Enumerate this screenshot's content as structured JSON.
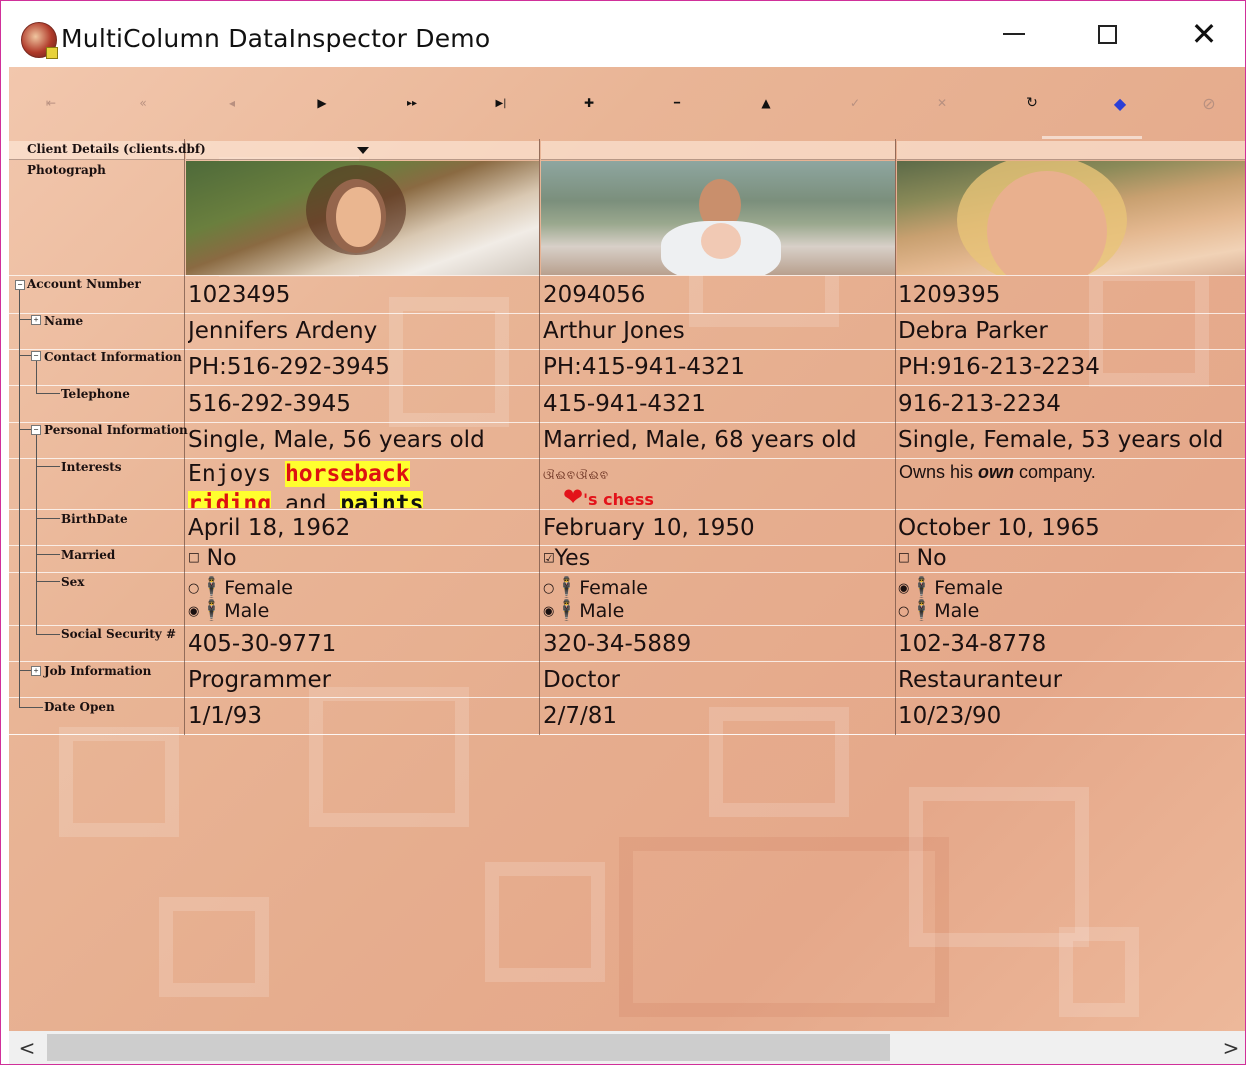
{
  "window": {
    "title": "MultiColumn DataInspector Demo",
    "minimize_icon": "minimize-icon",
    "maximize_icon": "maximize-icon",
    "close_glyph": "✕"
  },
  "toolbar": {
    "buttons": [
      {
        "name": "first-record",
        "glyph": "⇤",
        "enabled": false
      },
      {
        "name": "previous-page",
        "glyph": "«",
        "enabled": false
      },
      {
        "name": "previous-record",
        "glyph": "◂",
        "enabled": false
      },
      {
        "name": "next-record",
        "glyph": "▶",
        "enabled": true
      },
      {
        "name": "next-page",
        "glyph": "▸▸",
        "enabled": true
      },
      {
        "name": "last-record",
        "glyph": "▶|",
        "enabled": true
      },
      {
        "name": "insert-record",
        "glyph": "✚",
        "enabled": true
      },
      {
        "name": "delete-record",
        "glyph": "━",
        "enabled": true
      },
      {
        "name": "edit-record",
        "glyph": "▲",
        "enabled": true
      },
      {
        "name": "post-edit",
        "glyph": "✓",
        "enabled": false
      },
      {
        "name": "cancel-edit",
        "glyph": "✕",
        "enabled": false
      },
      {
        "name": "refresh-data",
        "glyph": "↻",
        "enabled": true
      },
      {
        "name": "apply-filter",
        "glyph": "◆",
        "enabled": true
      },
      {
        "name": "clear-filter",
        "glyph": "⊘",
        "enabled": false
      }
    ]
  },
  "grid": {
    "header_label": "Client Details (clients.dbf)",
    "fields": [
      {
        "label": "Photograph"
      },
      {
        "label": "Account Number"
      },
      {
        "label": "Name"
      },
      {
        "label": "Contact Information"
      },
      {
        "label": "Telephone"
      },
      {
        "label": "Personal Information"
      },
      {
        "label": "Interests"
      },
      {
        "label": "BirthDate"
      },
      {
        "label": "Married"
      },
      {
        "label": "Sex"
      },
      {
        "label": "Social Security #"
      },
      {
        "label": "Job Information"
      },
      {
        "label": "Date Open"
      }
    ],
    "records": [
      {
        "account": "1023495",
        "name": "Jennifers Ardeny",
        "contact": "PH:516-292-3945",
        "telephone": "516-292-3945",
        "personal": "Single, Male, 56 years old",
        "interests": {
          "w1": "Enjoys ",
          "w2": "horseback",
          "w3": "riding",
          "w4": " and ",
          "w5": "paints"
        },
        "birthdate": "April 18, 1962",
        "married": {
          "checked": false,
          "label": "No"
        },
        "sex": {
          "female": "Female",
          "male": "Male",
          "selected": "Male"
        },
        "ssn": "405-30-9771",
        "job": "Programmer",
        "date_open": "1/1/93"
      },
      {
        "account": "2094056",
        "name": "Arthur Jones",
        "contact": "PH:415-941-4321",
        "telephone": "415-941-4321",
        "personal": "Married, Male, 68 years old",
        "interests": {
          "line1": "ଔଈଵଔଈଵ",
          "heart": "❤",
          "suffix": "'s chess"
        },
        "birthdate": "February 10, 1950",
        "married": {
          "checked": true,
          "label": "Yes"
        },
        "sex": {
          "female": "Female",
          "male": "Male",
          "selected": "Male"
        },
        "ssn": "320-34-5889",
        "job": "Doctor",
        "date_open": "2/7/81"
      },
      {
        "account": "1209395",
        "name": "Debra Parker",
        "contact": "PH:916-213-2234",
        "telephone": "916-213-2234",
        "personal": "Single, Female, 53 years old",
        "interests": {
          "pre": "Owns his ",
          "em": "own",
          "post": " company."
        },
        "birthdate": "October 10, 1965",
        "married": {
          "checked": false,
          "label": "No"
        },
        "sex": {
          "female": "Female",
          "male": "Male",
          "selected": "Female"
        },
        "ssn": "102-34-8778",
        "job": "Restauranteur",
        "date_open": "10/23/90"
      }
    ]
  },
  "scrollbar": {
    "left": "<",
    "right": ">"
  },
  "colors": {
    "accent_border": "#d0309a",
    "highlight": "#ffff2e",
    "highlight_text": "#dd1111"
  }
}
